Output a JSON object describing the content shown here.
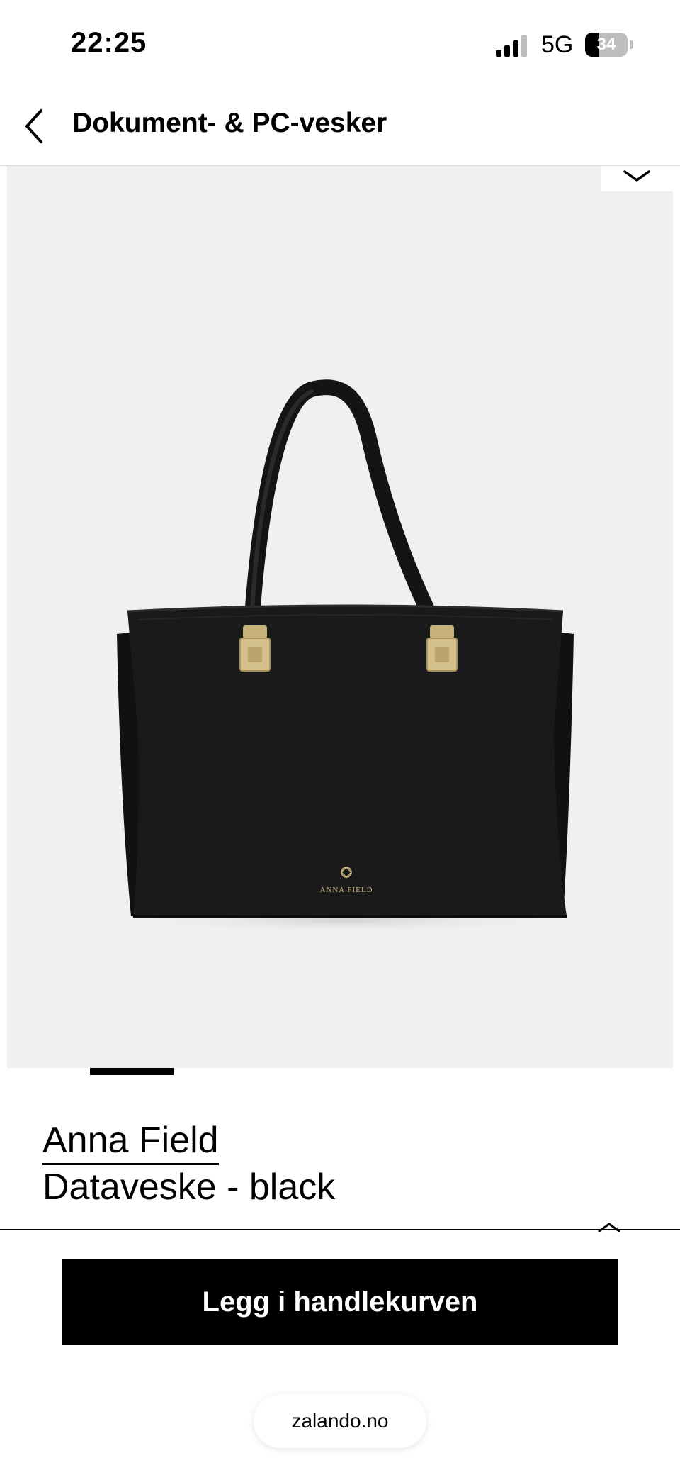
{
  "status_bar": {
    "time": "22:25",
    "network": "5G",
    "battery_percent": "34",
    "battery_level": 0.34
  },
  "nav": {
    "back_icon": "chevron-left-icon",
    "title": "Dokument- & PC-vesker"
  },
  "product_image": {
    "description_icon": "handbag-image",
    "logo_text": "ANNA FIELD",
    "collapse_icon": "chevron-down-icon"
  },
  "carousel": {
    "active_index": 1
  },
  "product": {
    "brand": "Anna Field",
    "name": "Dataveske - black"
  },
  "bottom_sheet": {
    "expand_icon": "chevron-up-icon",
    "add_to_cart_label": "Legg i handlekurven"
  },
  "browser": {
    "url": "zalando.no"
  },
  "colors": {
    "primary_button": "#000000",
    "image_background": "#f0f0f0"
  }
}
